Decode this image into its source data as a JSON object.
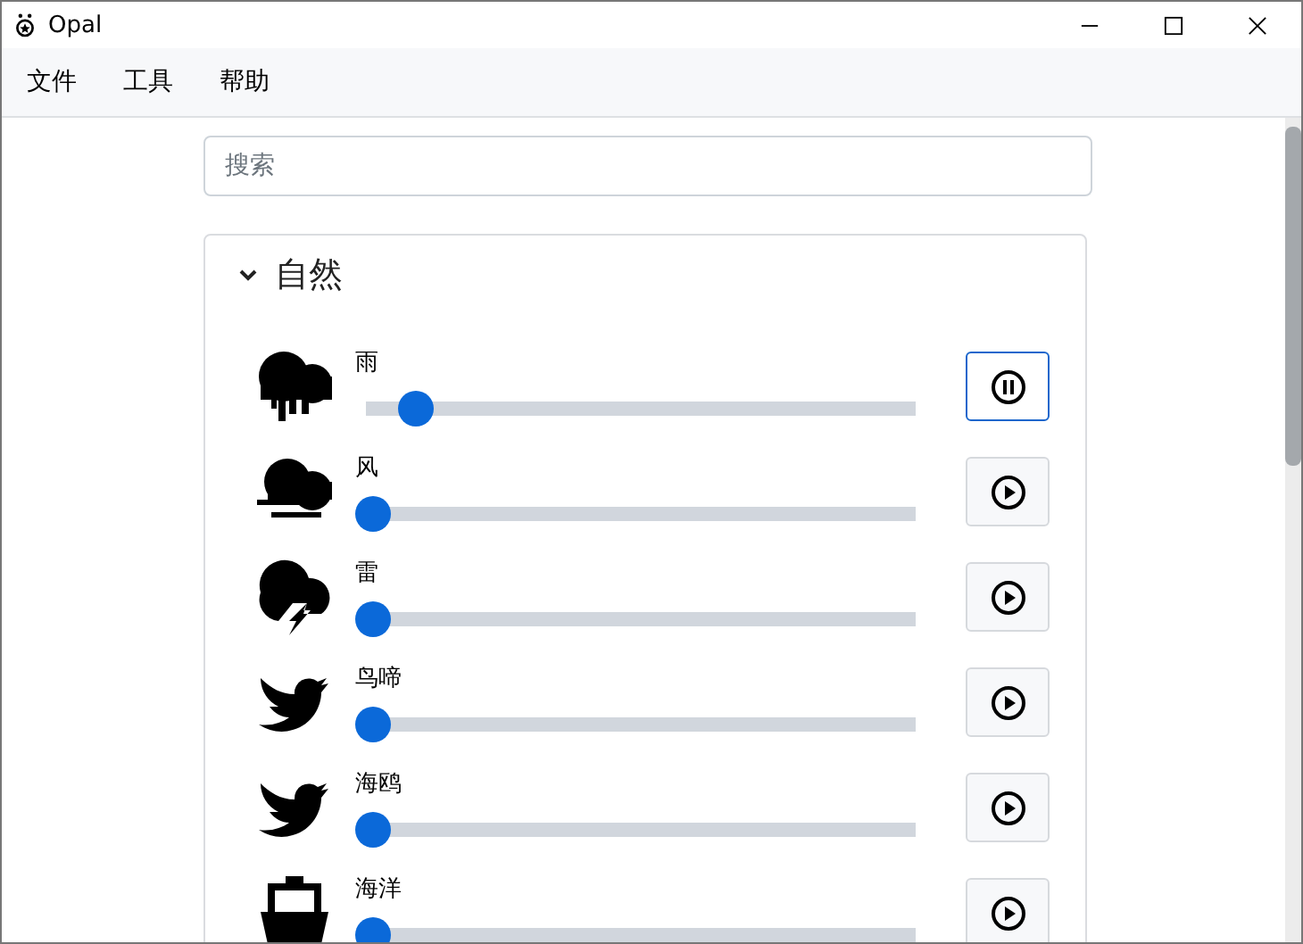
{
  "window": {
    "title": "Opal"
  },
  "menu": [
    "文件",
    "工具",
    "帮助"
  ],
  "search": {
    "placeholder": "搜索"
  },
  "category": {
    "title": "自然",
    "expanded": true,
    "sounds": [
      {
        "name": "雨",
        "kind": "rain",
        "level": 0.08,
        "playing": true
      },
      {
        "name": "风",
        "kind": "wind",
        "level": 0,
        "playing": false
      },
      {
        "name": "雷",
        "kind": "thunder",
        "level": 0,
        "playing": false
      },
      {
        "name": "鸟啼",
        "kind": "bird",
        "level": 0,
        "playing": false
      },
      {
        "name": "海鸥",
        "kind": "bird",
        "level": 0,
        "playing": false
      },
      {
        "name": "海洋",
        "kind": "ship",
        "level": 0,
        "playing": false
      }
    ]
  }
}
